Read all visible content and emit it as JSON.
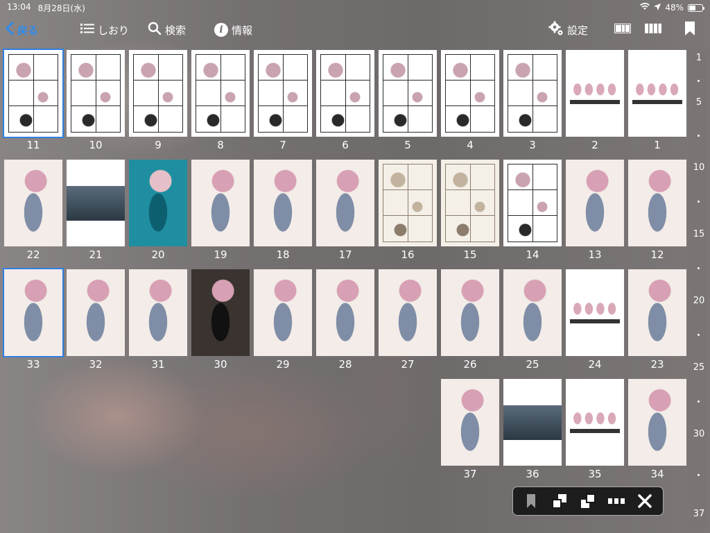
{
  "status_bar": {
    "time": "13:04",
    "date": "8月28日(水)",
    "battery": "48%",
    "battery_level": 0.48,
    "icons": [
      "wifi-icon",
      "location-icon",
      "battery-icon"
    ]
  },
  "toolbar": {
    "back_label": "戻る",
    "bookmarks_label": "しおり",
    "search_label": "検索",
    "info_label": "情報",
    "settings_label": "設定"
  },
  "colors": {
    "accent": "#2d8cf0",
    "selection": "#2f7fe0",
    "floatbar_bg": "#141414"
  },
  "pages": [
    {
      "num": "11",
      "tone": "manga",
      "selected": true
    },
    {
      "num": "10",
      "tone": "manga"
    },
    {
      "num": "9",
      "tone": "manga"
    },
    {
      "num": "8",
      "tone": "manga"
    },
    {
      "num": "7",
      "tone": "manga"
    },
    {
      "num": "6",
      "tone": "manga"
    },
    {
      "num": "5",
      "tone": "manga"
    },
    {
      "num": "4",
      "tone": "manga"
    },
    {
      "num": "3",
      "tone": "manga"
    },
    {
      "num": "2",
      "tone": "lineup"
    },
    {
      "num": "1",
      "tone": "lineup"
    },
    {
      "num": "22",
      "tone": "color"
    },
    {
      "num": "21",
      "tone": "photo"
    },
    {
      "num": "20",
      "tone": "pool"
    },
    {
      "num": "19",
      "tone": "color"
    },
    {
      "num": "18",
      "tone": "color"
    },
    {
      "num": "17",
      "tone": "color"
    },
    {
      "num": "16",
      "tone": "sepia"
    },
    {
      "num": "15",
      "tone": "sepia"
    },
    {
      "num": "14",
      "tone": "manga"
    },
    {
      "num": "13",
      "tone": "color"
    },
    {
      "num": "12",
      "tone": "color"
    },
    {
      "num": "33",
      "tone": "color",
      "selected": true
    },
    {
      "num": "32",
      "tone": "color"
    },
    {
      "num": "31",
      "tone": "color"
    },
    {
      "num": "30",
      "tone": "dark"
    },
    {
      "num": "29",
      "tone": "color"
    },
    {
      "num": "28",
      "tone": "color"
    },
    {
      "num": "27",
      "tone": "color"
    },
    {
      "num": "26",
      "tone": "color"
    },
    {
      "num": "25",
      "tone": "color"
    },
    {
      "num": "24",
      "tone": "lineup"
    },
    {
      "num": "23",
      "tone": "color"
    },
    {
      "num": "37",
      "tone": "color"
    },
    {
      "num": "36",
      "tone": "photo"
    },
    {
      "num": "35",
      "tone": "lineup"
    },
    {
      "num": "34",
      "tone": "color"
    }
  ],
  "scrubber": {
    "marks": [
      "1",
      "5",
      "10",
      "15",
      "20",
      "25",
      "30",
      "37"
    ]
  },
  "floating_bar": {
    "buttons": [
      "bookmark-icon",
      "page-back-icon",
      "page-forward-icon",
      "more-icon",
      "close-icon"
    ]
  }
}
